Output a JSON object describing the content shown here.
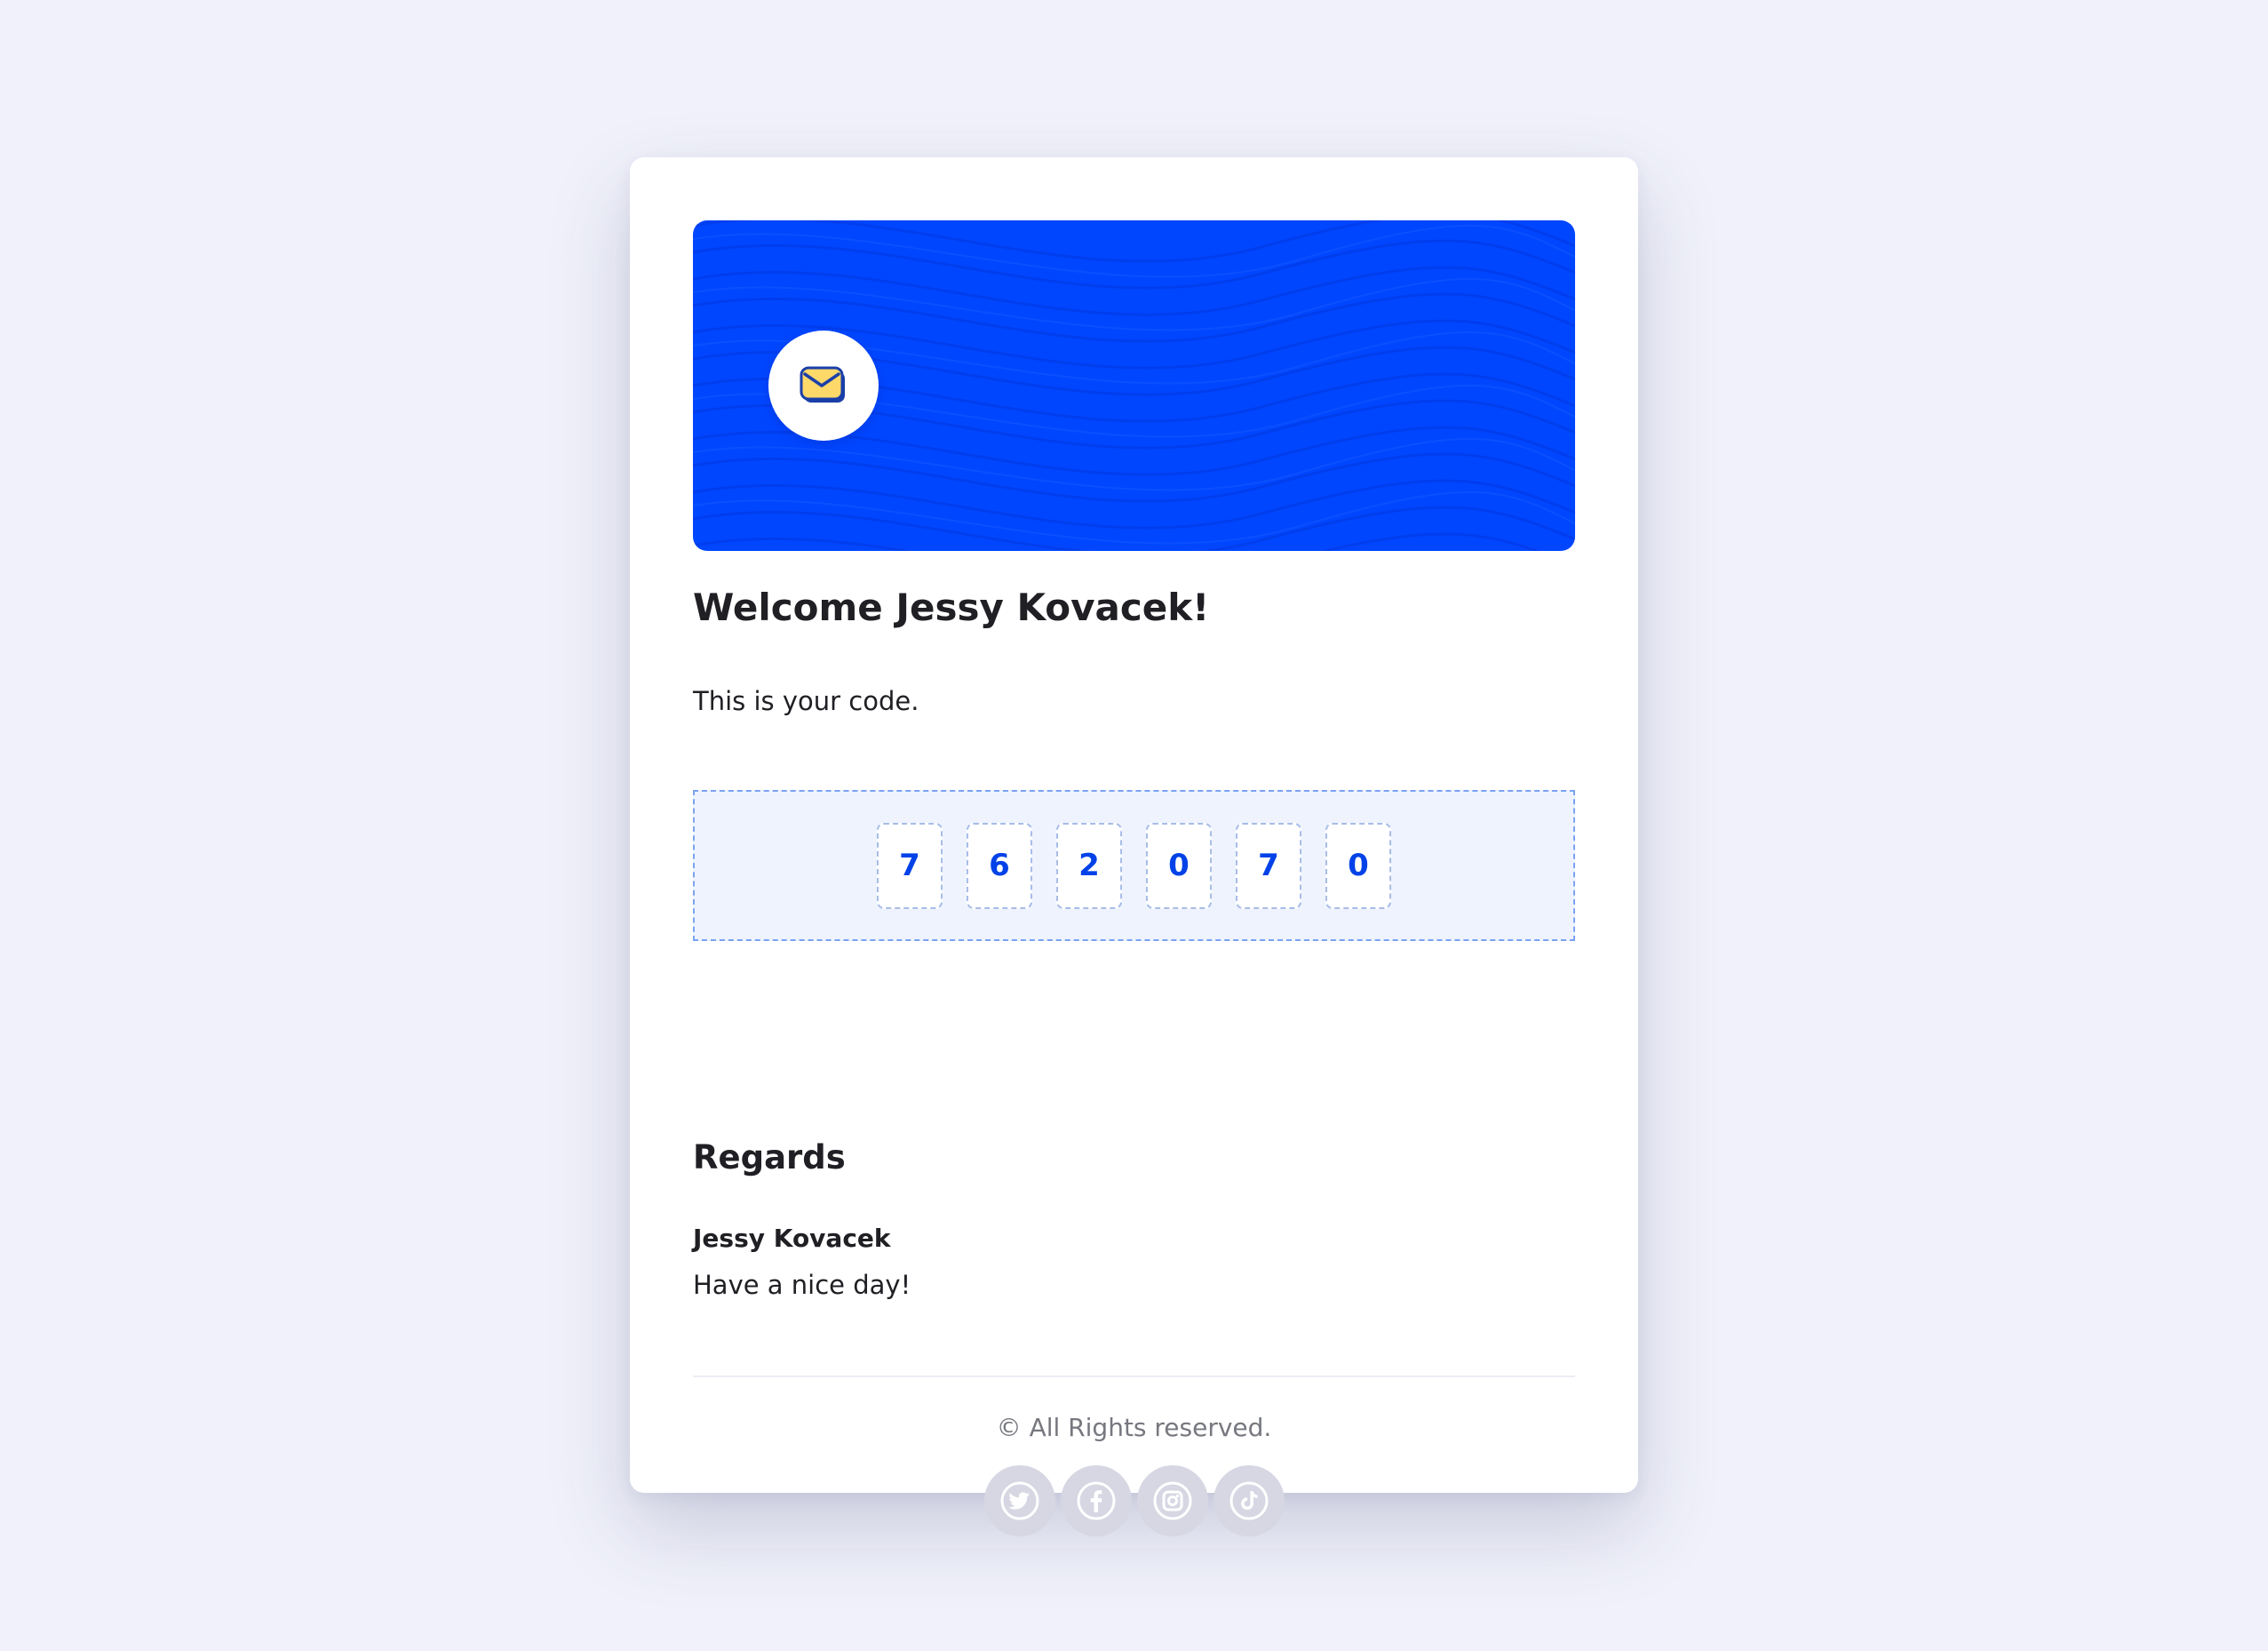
{
  "email": {
    "greeting": "Welcome Jessy Kovacek!",
    "intro": "This is your code.",
    "code_digits": [
      "7",
      "6",
      "2",
      "0",
      "7",
      "0"
    ],
    "regards_title": "Regards",
    "sender_name": "Jessy Kovacek",
    "sign_off": "Have a nice day!",
    "copyright": "© All Rights reserved."
  },
  "header_icon": "envelope-icon",
  "social": [
    "twitter-icon",
    "facebook-icon",
    "instagram-icon",
    "tiktok-icon"
  ],
  "colors": {
    "background": "#f0f1fa",
    "brand_blue": "#0046ff",
    "code_digit": "#0042e8",
    "envelope_fill": "#ffd86a",
    "social_bg": "#d6d7e3"
  }
}
